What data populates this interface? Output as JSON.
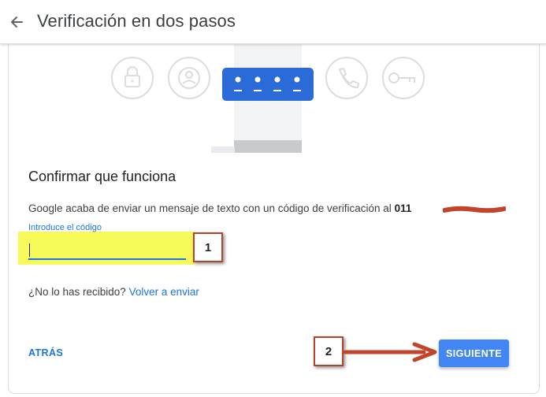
{
  "header": {
    "back_icon": "arrow-left-icon",
    "title": "Verificación en dos pasos"
  },
  "illustration": {
    "icons": [
      "lock-icon",
      "account-icon",
      "phone-icon",
      "key-icon"
    ],
    "code_dots": 4,
    "accent_color": "#2a6bd8"
  },
  "section": {
    "title": "Confirmar que funciona",
    "description": "Google acaba de enviar un mensaje de texto con un código de verificación al",
    "phone_visible": "011"
  },
  "code_field": {
    "label": "Introduce el código",
    "value": ""
  },
  "resend": {
    "question": "¿No lo has recibido?",
    "link": "Volver a enviar"
  },
  "actions": {
    "back_label": "ATRÁS",
    "next_label": "SIGUIENTE"
  },
  "annotations": {
    "badge_1": "1",
    "badge_2": "2",
    "arrow_color": "#c0452a",
    "highlight_color": "#f6fb5a"
  }
}
